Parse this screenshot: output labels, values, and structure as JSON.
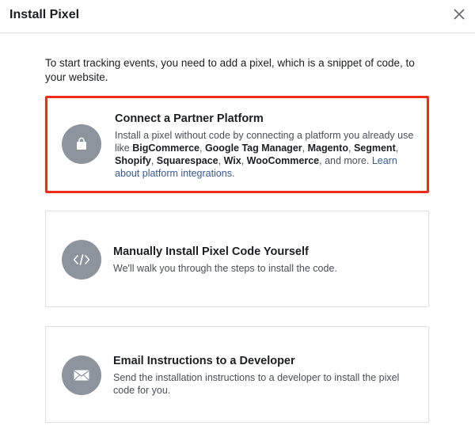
{
  "dialog": {
    "title": "Install Pixel",
    "intro": "To start tracking events, you need to add a pixel, which is a snippet of code, to your website."
  },
  "options": [
    {
      "title": "Connect a Partner Platform",
      "desc_prefix": "Install a pixel without code by connecting a platform you already use like ",
      "platforms": [
        "BigCommerce",
        "Google Tag Manager",
        "Magento",
        "Segment",
        "Shopify",
        "Squarespace",
        "Wix",
        "WooCommerce"
      ],
      "desc_suffix": ", and more. ",
      "link": "Learn about platform integrations",
      "period": ".",
      "icon": "shopping-bag-icon",
      "selected": true
    },
    {
      "title": "Manually Install Pixel Code Yourself",
      "desc": "We'll walk you through the steps to install the code.",
      "icon": "code-icon"
    },
    {
      "title": "Email Instructions to a Developer",
      "desc": "Send the installation instructions to a developer to install the pixel code for you.",
      "icon": "envelope-icon"
    }
  ],
  "colors": {
    "highlight": "#f02d1b",
    "icon_bg": "#8d949e",
    "link": "#385898"
  }
}
